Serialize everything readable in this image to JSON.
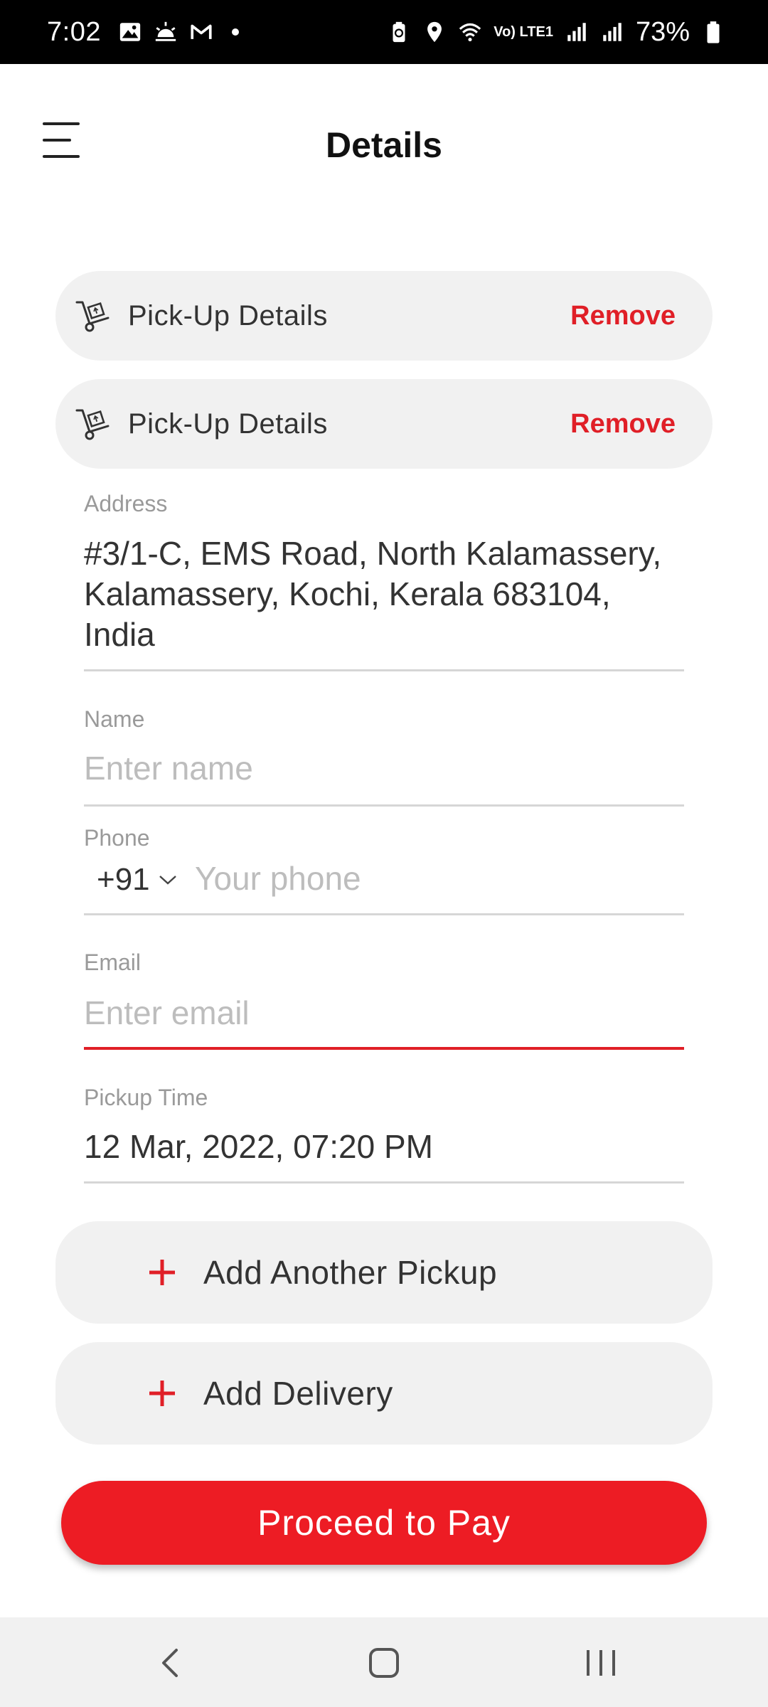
{
  "status_bar": {
    "time": "7:02",
    "battery": "73%",
    "lte_label": "Vo) LTE1",
    "left_icons": [
      "gallery-icon",
      "weather-icon",
      "gmail-icon",
      "notification-dot"
    ],
    "right_icons": [
      "battery-saver-icon",
      "location-icon",
      "wifi-icon",
      "signal-icon",
      "signal-icon",
      "battery-icon"
    ]
  },
  "header": {
    "title": "Details",
    "menu_icon": "hamburger-menu-icon"
  },
  "pickups": [
    {
      "title": "Pick-Up Details",
      "remove_label": "Remove",
      "icon": "hand-truck-icon"
    },
    {
      "title": "Pick-Up Details",
      "remove_label": "Remove",
      "icon": "hand-truck-icon"
    }
  ],
  "form": {
    "address": {
      "label": "Address",
      "value": "#3/1-C, EMS Road, North Kalamassery, Kalamassery, Kochi, Kerala 683104, India"
    },
    "name": {
      "label": "Name",
      "value": "",
      "placeholder": "Enter name"
    },
    "phone": {
      "label": "Phone",
      "country_code": "+91",
      "value": "",
      "placeholder": "Your phone"
    },
    "email": {
      "label": "Email",
      "value": "",
      "placeholder": "Enter email"
    },
    "pickup_time": {
      "label": "Pickup Time",
      "value": "12 Mar, 2022, 07:20 PM"
    }
  },
  "actions": {
    "add_pickup_label": "Add Another Pickup",
    "add_delivery_label": "Add Delivery",
    "proceed_label": "Proceed to Pay"
  },
  "colors": {
    "accent": "#ed1c24",
    "remove_text": "#e01f27",
    "pill_bg": "#f1f1f1"
  },
  "nav_bar": {
    "buttons": [
      "back-icon",
      "home-icon",
      "recents-icon"
    ]
  }
}
